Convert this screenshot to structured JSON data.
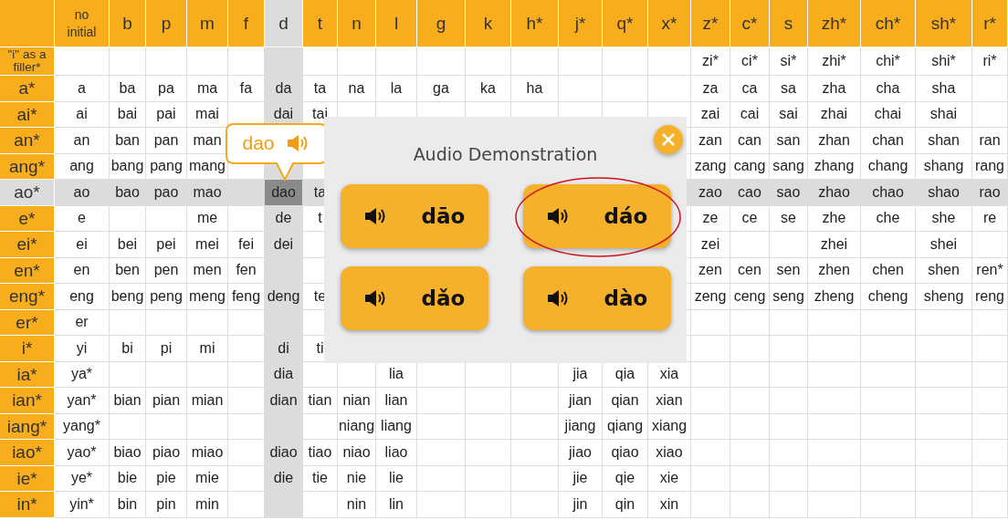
{
  "table": {
    "columns": [
      {
        "label": "no initial",
        "selected": false
      },
      {
        "label": "b",
        "selected": false
      },
      {
        "label": "p",
        "selected": false
      },
      {
        "label": "m",
        "selected": false
      },
      {
        "label": "f",
        "selected": false
      },
      {
        "label": "d",
        "selected": true
      },
      {
        "label": "t",
        "selected": false
      },
      {
        "label": "n",
        "selected": false
      },
      {
        "label": "l",
        "selected": false
      },
      {
        "label": "g",
        "selected": false
      },
      {
        "label": "k",
        "selected": false
      },
      {
        "label": "h*",
        "selected": false
      },
      {
        "label": "j*",
        "selected": false
      },
      {
        "label": "q*",
        "selected": false
      },
      {
        "label": "x*",
        "selected": false
      },
      {
        "label": "z*",
        "selected": false
      },
      {
        "label": "c*",
        "selected": false
      },
      {
        "label": "s",
        "selected": false
      },
      {
        "label": "zh*",
        "selected": false
      },
      {
        "label": "ch*",
        "selected": false
      },
      {
        "label": "sh*",
        "selected": false
      },
      {
        "label": "r*",
        "selected": false
      }
    ],
    "rows": [
      {
        "label": "\"i\" as a filler*",
        "selected": false,
        "cells": [
          null,
          null,
          null,
          null,
          null,
          null,
          null,
          null,
          null,
          null,
          null,
          null,
          null,
          null,
          null,
          "zi*",
          "ci*",
          "si*",
          "zhi*",
          "chi*",
          "shi*",
          "ri*"
        ]
      },
      {
        "label": "a*",
        "selected": false,
        "cells": [
          "a",
          "ba",
          "pa",
          "ma",
          "fa",
          "da",
          "ta",
          "na",
          "la",
          "ga",
          "ka",
          "ha",
          null,
          null,
          null,
          "za",
          "ca",
          "sa",
          "zha",
          "cha",
          "sha",
          null
        ]
      },
      {
        "label": "ai*",
        "selected": false,
        "cells": [
          "ai",
          "bai",
          "pai",
          "mai",
          null,
          "dai",
          "tai",
          null,
          null,
          null,
          null,
          null,
          null,
          null,
          null,
          "zai",
          "cai",
          "sai",
          "zhai",
          "chai",
          "shai",
          null
        ]
      },
      {
        "label": "an*",
        "selected": false,
        "cells": [
          "an",
          "ban",
          "pan",
          "man",
          null,
          null,
          null,
          null,
          null,
          null,
          null,
          null,
          null,
          null,
          null,
          "zan",
          "can",
          "san",
          "zhan",
          "chan",
          "shan",
          "ran"
        ]
      },
      {
        "label": "ang*",
        "selected": false,
        "cells": [
          "ang",
          "bang",
          "pang",
          "mang",
          null,
          null,
          null,
          null,
          null,
          null,
          null,
          null,
          null,
          null,
          null,
          "zang",
          "cang",
          "sang",
          "zhang",
          "chang",
          "shang",
          "rang"
        ]
      },
      {
        "label": "ao*",
        "selected": true,
        "cells": [
          "ao",
          "bao",
          "pao",
          "mao",
          null,
          "dao",
          "ta",
          null,
          null,
          null,
          null,
          null,
          null,
          null,
          null,
          "zao",
          "cao",
          "sao",
          "zhao",
          "chao",
          "shao",
          "rao"
        ]
      },
      {
        "label": "e*",
        "selected": false,
        "cells": [
          "e",
          null,
          null,
          "me",
          null,
          "de",
          "t",
          null,
          null,
          null,
          null,
          null,
          null,
          null,
          null,
          "ze",
          "ce",
          "se",
          "zhe",
          "che",
          "she",
          "re"
        ]
      },
      {
        "label": "ei*",
        "selected": false,
        "cells": [
          "ei",
          "bei",
          "pei",
          "mei",
          "fei",
          "dei",
          null,
          null,
          null,
          null,
          null,
          null,
          null,
          null,
          null,
          "zei",
          null,
          null,
          "zhei",
          null,
          "shei",
          null
        ]
      },
      {
        "label": "en*",
        "selected": false,
        "cells": [
          "en",
          "ben",
          "pen",
          "men",
          "fen",
          null,
          null,
          null,
          null,
          null,
          null,
          null,
          null,
          null,
          null,
          "zen",
          "cen",
          "sen",
          "zhen",
          "chen",
          "shen",
          "ren*"
        ]
      },
      {
        "label": "eng*",
        "selected": false,
        "cells": [
          "eng",
          "beng",
          "peng",
          "meng",
          "feng",
          "deng",
          "te",
          null,
          null,
          null,
          null,
          null,
          null,
          null,
          null,
          "zeng",
          "ceng",
          "seng",
          "zheng",
          "cheng",
          "sheng",
          "reng"
        ]
      },
      {
        "label": "er*",
        "selected": false,
        "cells": [
          "er"
        ]
      },
      {
        "label": "i*",
        "selected": false,
        "cells": [
          "yi",
          "bi",
          "pi",
          "mi",
          null,
          "di",
          "ti"
        ]
      },
      {
        "label": "ia*",
        "selected": false,
        "cells": [
          "ya*",
          null,
          null,
          null,
          null,
          "dia",
          null,
          null,
          "lia",
          null,
          null,
          null,
          "jia",
          "qia",
          "xia"
        ]
      },
      {
        "label": "ian*",
        "selected": false,
        "cells": [
          "yan*",
          "bian",
          "pian",
          "mian",
          null,
          "dian",
          "tian",
          "nian",
          "lian",
          null,
          null,
          null,
          "jian",
          "qian",
          "xian"
        ]
      },
      {
        "label": "iang*",
        "selected": false,
        "cells": [
          "yang*",
          null,
          null,
          null,
          null,
          null,
          null,
          "niang",
          "liang",
          null,
          null,
          null,
          "jiang",
          "qiang",
          "xiang"
        ]
      },
      {
        "label": "iao*",
        "selected": false,
        "cells": [
          "yao*",
          "biao",
          "piao",
          "miao",
          null,
          "diao",
          "tiao",
          "niao",
          "liao",
          null,
          null,
          null,
          "jiao",
          "qiao",
          "xiao"
        ]
      },
      {
        "label": "ie*",
        "selected": false,
        "cells": [
          "ye*",
          "bie",
          "pie",
          "mie",
          null,
          "die",
          "tie",
          "nie",
          "lie",
          null,
          null,
          null,
          "jie",
          "qie",
          "xie"
        ]
      },
      {
        "label": "in*",
        "selected": false,
        "cells": [
          "yin*",
          "bin",
          "pin",
          "min",
          null,
          null,
          null,
          "nin",
          "lin",
          null,
          null,
          null,
          "jin",
          "qin",
          "xin"
        ]
      }
    ]
  },
  "tooltip": {
    "label": "dao"
  },
  "dialog": {
    "title": "Audio Demonstration",
    "options": [
      {
        "label": "dāo",
        "circled": false
      },
      {
        "label": "dáo",
        "circled": true
      },
      {
        "label": "dǎo",
        "circled": false
      },
      {
        "label": "dào",
        "circled": false
      }
    ]
  }
}
